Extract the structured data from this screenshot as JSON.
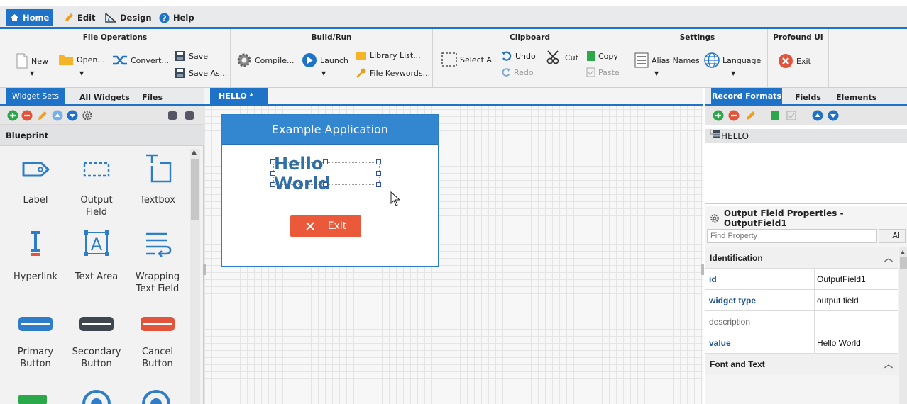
{
  "menu": {
    "tabs": [
      {
        "label": "Home",
        "icon": "home-icon"
      },
      {
        "label": "Edit",
        "icon": "pencil-icon"
      },
      {
        "label": "Design",
        "icon": "design-icon"
      },
      {
        "label": "Help",
        "icon": "help-icon"
      }
    ]
  },
  "ribbon": {
    "groups": {
      "file": "File Operations",
      "build": "Build/Run",
      "clipboard": "Clipboard",
      "settings": "Settings",
      "profound": "Profound UI"
    },
    "buttons": {
      "new": "New",
      "open": "Open...",
      "convert": "Convert...",
      "save": "Save",
      "save_as": "Save As...",
      "compile": "Compile...",
      "launch": "Launch",
      "library_list": "Library List...",
      "file_keywords": "File Keywords...",
      "select_all": "Select All",
      "undo": "Undo",
      "redo": "Redo",
      "cut": "Cut",
      "copy": "Copy",
      "paste": "Paste",
      "alias_names": "Alias Names",
      "language": "Language",
      "exit": "Exit"
    }
  },
  "left_panel": {
    "tabs": [
      "Widget Sets",
      "All Widgets",
      "Files"
    ],
    "section": "Blueprint",
    "collapse": "–",
    "widgets": [
      {
        "label": "Label",
        "icon": "label-icon"
      },
      {
        "label": "Output\nField",
        "lines": [
          "Output",
          "Field"
        ],
        "icon": "output-field-icon"
      },
      {
        "label": "Textbox",
        "icon": "textbox-icon"
      },
      {
        "label": "Hyperlink",
        "icon": "hyperlink-icon"
      },
      {
        "label": "Text Area",
        "icon": "text-area-icon"
      },
      {
        "label": "Wrapping Text Field",
        "lines": [
          "Wrapping",
          "Text Field"
        ],
        "icon": "wrapping-text-icon"
      },
      {
        "label": "Primary Button",
        "lines": [
          "Primary",
          "Button"
        ],
        "icon": "primary-button-icon",
        "color": "#2d7dc8"
      },
      {
        "label": "Secondary Button",
        "lines": [
          "Secondary",
          "Button"
        ],
        "icon": "secondary-button-icon",
        "color": "#3f4650"
      },
      {
        "label": "Cancel Button",
        "lines": [
          "Cancel",
          "Button"
        ],
        "icon": "cancel-button-icon",
        "color": "#e2553c"
      }
    ]
  },
  "canvas": {
    "tab": "HELLO *",
    "app_title": "Example Application",
    "output_field": "Hello World",
    "exit_button": "Exit"
  },
  "right_panel": {
    "tabs": [
      "Record Formats",
      "Fields",
      "Elements"
    ],
    "record": "HELLO",
    "props_title": "Output Field Properties - OutputField1",
    "find_placeholder": "Find Property",
    "all_label": "All",
    "sections": {
      "identification": "Identification",
      "font": "Font and Text"
    },
    "properties": [
      {
        "name": "id",
        "value": "OutputField1",
        "bold": true
      },
      {
        "name": "widget type",
        "value": "output field",
        "bold": true
      },
      {
        "name": "description",
        "value": "",
        "bold": false
      },
      {
        "name": "value",
        "value": "Hello World",
        "bold": true
      }
    ]
  },
  "colors": {
    "accent": "#1e73c8",
    "exit": "#ea5a3a",
    "green": "#2aa84a",
    "red": "#e2553c"
  }
}
